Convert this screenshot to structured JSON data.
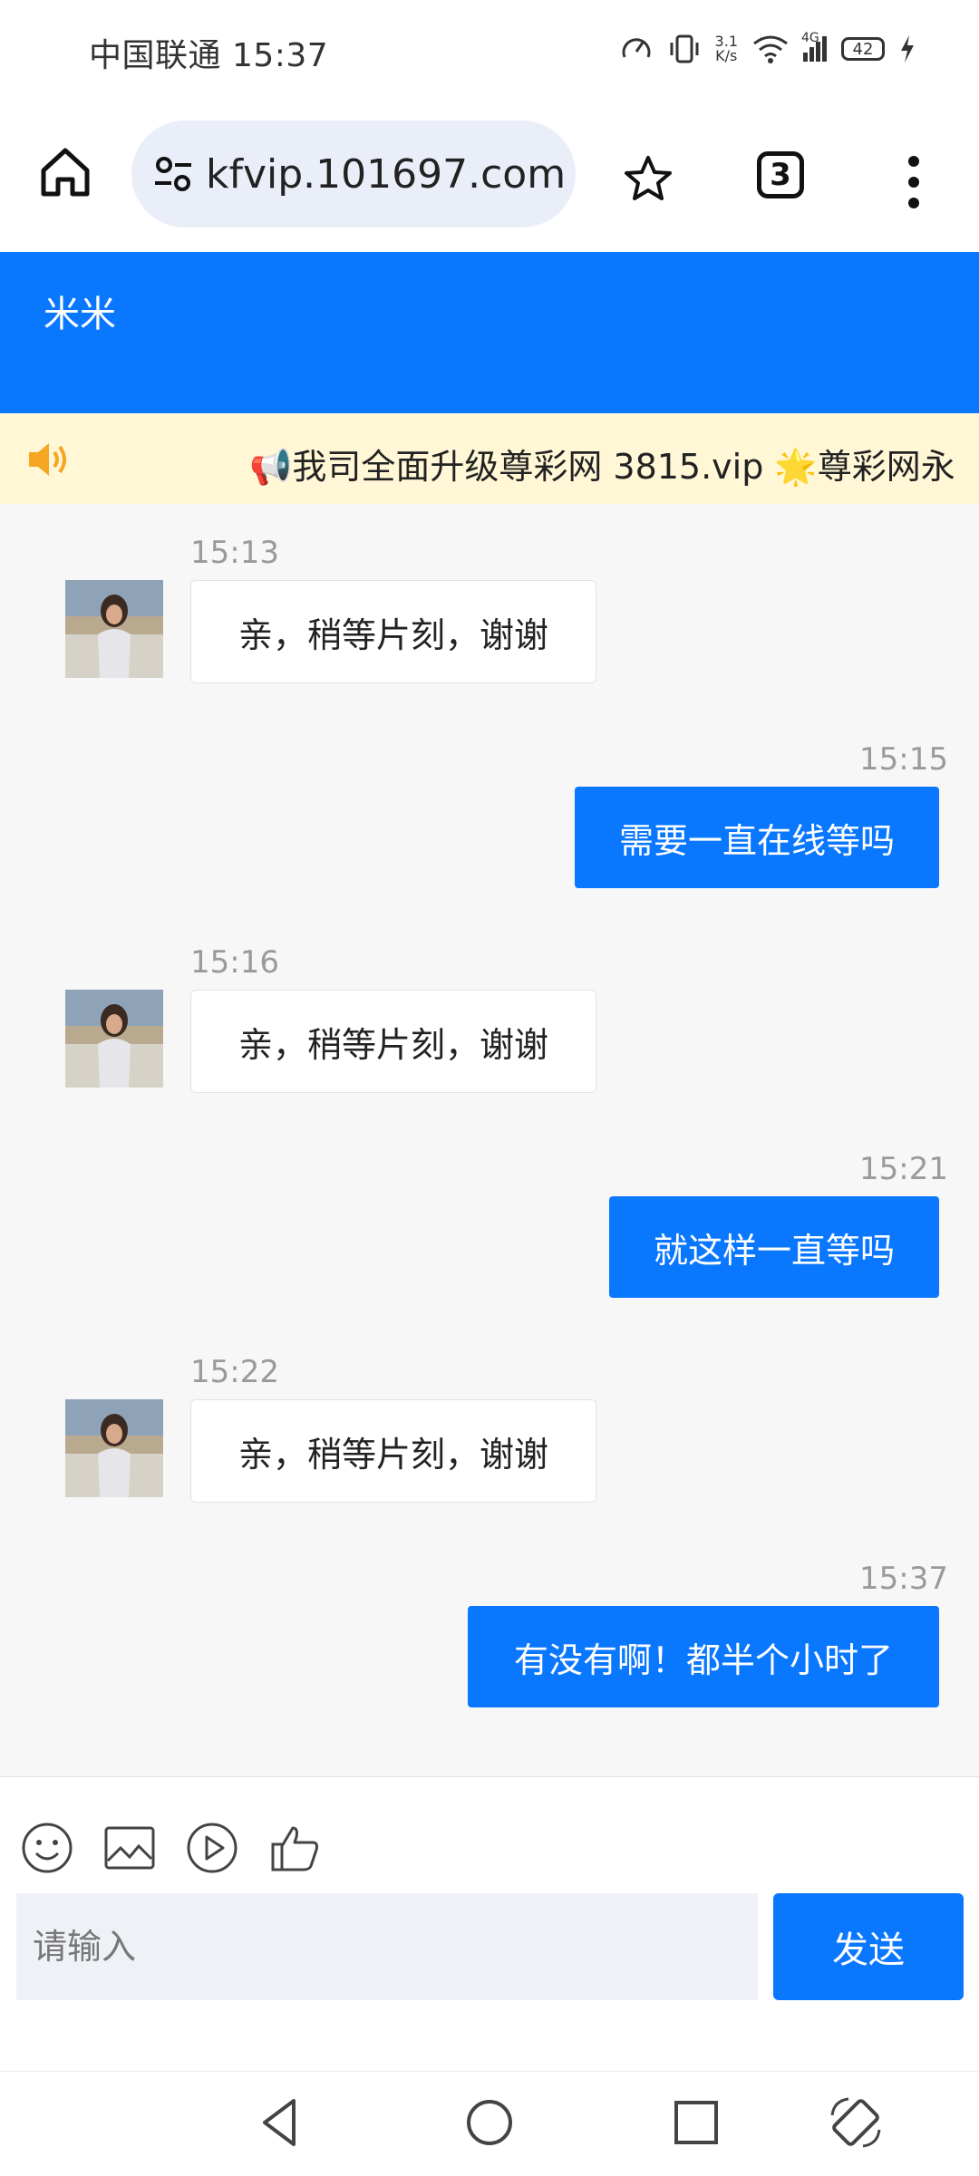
{
  "status_bar": {
    "carrier_time": "中国联通 15:37",
    "net_speed_value": "3.1",
    "net_speed_unit": "K/s",
    "network_type": "4G",
    "battery": "42"
  },
  "browser": {
    "url": "kfvip.101697.com",
    "tab_count": "3"
  },
  "header": {
    "title": "米米"
  },
  "announcement": {
    "text": "📢我司全面升级尊彩网 3815.vip 🌟尊彩网永"
  },
  "messages": [
    {
      "time": "15:13",
      "side": "in",
      "text": "亲，稍等片刻，谢谢"
    },
    {
      "time": "15:15",
      "side": "out",
      "text": "需要一直在线等吗"
    },
    {
      "time": "15:16",
      "side": "in",
      "text": "亲，稍等片刻，谢谢"
    },
    {
      "time": "15:21",
      "side": "out",
      "text": "就这样一直等吗"
    },
    {
      "time": "15:22",
      "side": "in",
      "text": "亲，稍等片刻，谢谢"
    },
    {
      "time": "15:37",
      "side": "out",
      "text": "有没有啊！都半个小时了"
    }
  ],
  "composer": {
    "placeholder": "请输入",
    "send_label": "发送"
  },
  "colors": {
    "accent": "#0a77ff",
    "announce_bg": "#fff7d6",
    "chat_bg": "#f7f7f7"
  }
}
